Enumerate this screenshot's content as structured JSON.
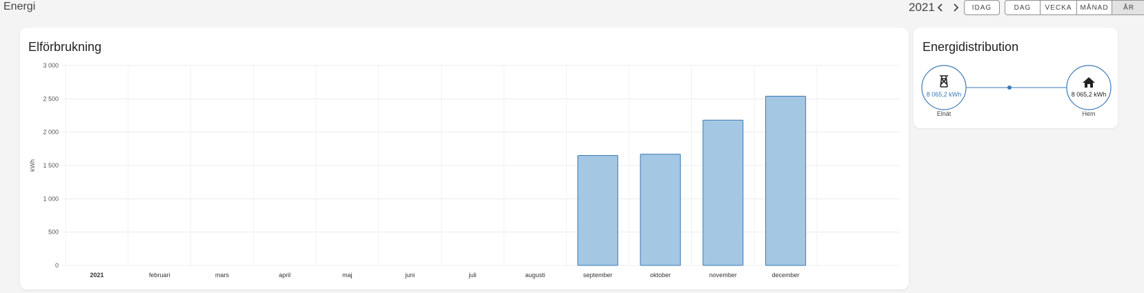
{
  "header": {
    "title": "Energi",
    "year": "2021",
    "buttons": {
      "today": "IDAG",
      "day": "DAG",
      "week": "VECKA",
      "month": "MÅNAD",
      "year": "ÅR"
    }
  },
  "consumption_card": {
    "title": "Elförbrukning"
  },
  "chart_data": {
    "type": "bar",
    "ylabel": "kWh",
    "ylim": [
      0,
      3000
    ],
    "yticks": [
      "3 000",
      "2 500",
      "2 000",
      "1 500",
      "1 000",
      "500",
      "0"
    ],
    "categories": [
      "2021",
      "februari",
      "mars",
      "april",
      "maj",
      "juni",
      "juli",
      "augusti",
      "september",
      "oktober",
      "november",
      "december"
    ],
    "values": [
      0,
      0,
      0,
      0,
      0,
      0,
      0,
      0,
      1650,
      1670,
      2180,
      2540
    ],
    "bar_color": "#a4c7e3",
    "bar_border": "#3b78b5",
    "grid": true
  },
  "distribution_card": {
    "title": "Energidistribution",
    "grid": {
      "value": "8 065,2 kWh",
      "label": "Elnät"
    },
    "home": {
      "value": "8 065,2 kWh",
      "label": "Hem"
    },
    "accent": "#3b78b5"
  }
}
